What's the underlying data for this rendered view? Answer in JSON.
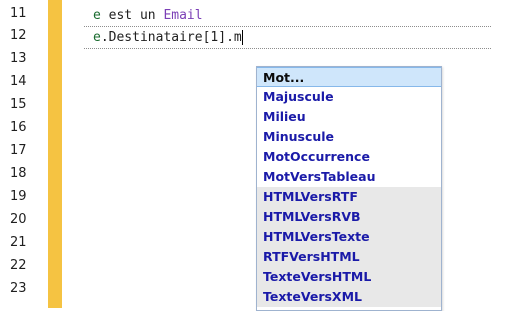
{
  "editor": {
    "line_numbers": [
      "11",
      "12",
      "13",
      "14",
      "15",
      "16",
      "17",
      "18",
      "19",
      "20",
      "21",
      "22",
      "23"
    ],
    "lines": {
      "line11": {
        "var": "e",
        "keyword": " est un ",
        "type": "Email"
      },
      "line12": {
        "var": "e",
        "member": ".Destinataire",
        "open": "[",
        "index": "1",
        "close": "]",
        "dot": ".",
        "typed": "m"
      }
    }
  },
  "autocomplete": {
    "items": [
      {
        "label": "Mot...",
        "state": "selected"
      },
      {
        "label": "Majuscule",
        "state": "normal"
      },
      {
        "label": "Milieu",
        "state": "normal"
      },
      {
        "label": "Minuscule",
        "state": "normal"
      },
      {
        "label": "MotOccurrence",
        "state": "normal"
      },
      {
        "label": "MotVersTableau",
        "state": "normal"
      },
      {
        "label": "HTMLVersRTF",
        "state": "gray"
      },
      {
        "label": "HTMLVersRVB",
        "state": "gray"
      },
      {
        "label": "HTMLVersTexte",
        "state": "gray"
      },
      {
        "label": "RTFVersHTML",
        "state": "gray"
      },
      {
        "label": "TexteVersHTML",
        "state": "gray"
      },
      {
        "label": "TexteVersXML",
        "state": "gray"
      }
    ]
  },
  "colors": {
    "change_bar": "#f5c342",
    "selected_item_bg": "#cfe6fb",
    "gray_item_bg": "#e8e8e8",
    "item_text": "#1a1aa8"
  }
}
